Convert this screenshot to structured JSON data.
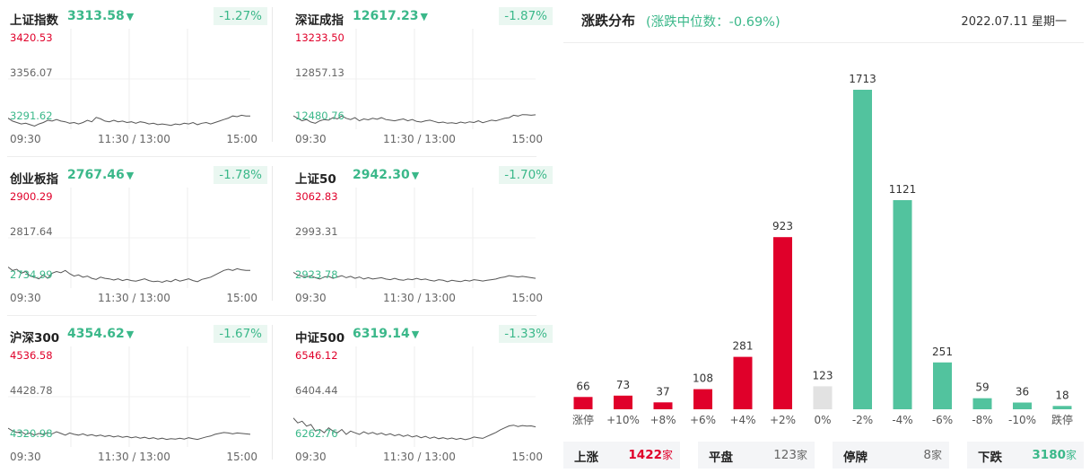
{
  "indices": [
    {
      "name": "上证指数",
      "value": "3313.58",
      "change": "-1.27%",
      "y_high": "3420.53",
      "y_mid": "3356.07",
      "y_low": "3291.62",
      "series": [
        3302,
        3298,
        3296,
        3294,
        3295,
        3293,
        3291,
        3294,
        3296,
        3299,
        3298,
        3300,
        3298,
        3297,
        3295,
        3296,
        3294,
        3296,
        3299,
        3297,
        3303,
        3301,
        3298,
        3297,
        3299,
        3297,
        3298,
        3296,
        3297,
        3295,
        3297,
        3296,
        3294,
        3295,
        3293,
        3294,
        3293,
        3292,
        3294,
        3293,
        3295,
        3294,
        3296,
        3293,
        3295,
        3296,
        3294,
        3296,
        3298,
        3300,
        3302,
        3305,
        3304,
        3306,
        3305,
        3305
      ]
    },
    {
      "name": "深证成指",
      "value": "12617.23",
      "change": "-1.87%",
      "y_high": "13233.50",
      "y_mid": "12857.13",
      "y_low": "12480.76",
      "series": [
        12560,
        12540,
        12520,
        12530,
        12510,
        12500,
        12520,
        12530,
        12525,
        12545,
        12535,
        12560,
        12540,
        12530,
        12545,
        12520,
        12535,
        12528,
        12540,
        12532,
        12545,
        12530,
        12525,
        12520,
        12528,
        12535,
        12520,
        12530,
        12515,
        12510,
        12520,
        12525,
        12515,
        12505,
        12510,
        12500,
        12505,
        12498,
        12510,
        12502,
        12512,
        12506,
        12520,
        12505,
        12515,
        12525,
        12520,
        12530,
        12540,
        12545,
        12565,
        12558,
        12570,
        12568,
        12565,
        12568
      ]
    },
    {
      "name": "创业板指",
      "value": "2767.46",
      "change": "-1.78%",
      "y_high": "2900.29",
      "y_mid": "2817.64",
      "y_low": "2734.99",
      "series": [
        2766,
        2760,
        2762,
        2755,
        2758,
        2750,
        2748,
        2745,
        2752,
        2746,
        2755,
        2758,
        2756,
        2760,
        2754,
        2750,
        2752,
        2748,
        2750,
        2746,
        2744,
        2748,
        2746,
        2745,
        2743,
        2745,
        2742,
        2744,
        2742,
        2741,
        2743,
        2745,
        2742,
        2740,
        2741,
        2739,
        2742,
        2740,
        2744,
        2741,
        2743,
        2745,
        2742,
        2740,
        2744,
        2746,
        2748,
        2752,
        2756,
        2760,
        2762,
        2760,
        2763,
        2761,
        2760,
        2760
      ]
    },
    {
      "name": "上证50",
      "value": "2942.30",
      "change": "-1.70%",
      "y_high": "3062.83",
      "y_mid": "2993.31",
      "y_low": "2923.78",
      "series": [
        2942,
        2938,
        2936,
        2935,
        2937,
        2934,
        2932,
        2935,
        2936,
        2933,
        2935,
        2937,
        2934,
        2936,
        2933,
        2935,
        2932,
        2934,
        2932,
        2933,
        2934,
        2932,
        2931,
        2933,
        2931,
        2930,
        2932,
        2931,
        2933,
        2931,
        2932,
        2930,
        2929,
        2931,
        2930,
        2928,
        2930,
        2929,
        2928,
        2930,
        2929,
        2931,
        2930,
        2929,
        2930,
        2931,
        2932,
        2934,
        2935,
        2937,
        2936,
        2935,
        2936,
        2935,
        2934,
        2933
      ]
    },
    {
      "name": "沪深300",
      "value": "4354.62",
      "change": "-1.67%",
      "y_high": "4536.58",
      "y_mid": "4428.78",
      "y_low": "4320.98",
      "series": [
        4356,
        4350,
        4346,
        4348,
        4342,
        4345,
        4340,
        4344,
        4341,
        4346,
        4343,
        4348,
        4344,
        4340,
        4345,
        4342,
        4340,
        4343,
        4339,
        4341,
        4338,
        4340,
        4337,
        4339,
        4336,
        4338,
        4335,
        4337,
        4334,
        4336,
        4333,
        4335,
        4332,
        4334,
        4331,
        4333,
        4330,
        4332,
        4331,
        4333,
        4331,
        4334,
        4332,
        4330,
        4333,
        4336,
        4338,
        4342,
        4344,
        4346,
        4345,
        4343,
        4345,
        4344,
        4343,
        4342
      ]
    },
    {
      "name": "中证500",
      "value": "6319.14",
      "change": "-1.33%",
      "y_high": "6546.12",
      "y_mid": "6404.44",
      "y_low": "6262.76",
      "series": [
        6340,
        6325,
        6330,
        6315,
        6320,
        6300,
        6305,
        6295,
        6310,
        6300,
        6295,
        6305,
        6290,
        6300,
        6295,
        6290,
        6298,
        6292,
        6296,
        6290,
        6294,
        6288,
        6292,
        6286,
        6290,
        6284,
        6288,
        6282,
        6286,
        6280,
        6284,
        6278,
        6282,
        6277,
        6280,
        6276,
        6279,
        6275,
        6278,
        6274,
        6277,
        6282,
        6280,
        6278,
        6284,
        6290,
        6296,
        6304,
        6310,
        6316,
        6318,
        6314,
        6317,
        6315,
        6316,
        6313
      ]
    }
  ],
  "time_labels": [
    "09:30",
    "11:30 / 13:00",
    "15:00"
  ],
  "distribution": {
    "title": "涨跌分布",
    "subtitle": "(涨跌中位数：-0.69%)",
    "date": "2022.07.11 星期一",
    "chart_data": {
      "type": "bar",
      "categories": [
        "涨停",
        "+10%",
        "+8%",
        "+6%",
        "+4%",
        "+2%",
        "0%",
        "-2%",
        "-4%",
        "-6%",
        "-8%",
        "-10%",
        "跌停"
      ],
      "values": [
        66,
        73,
        37,
        108,
        281,
        923,
        123,
        1713,
        1121,
        251,
        59,
        36,
        18
      ],
      "colors": [
        "#e0002a",
        "#e0002a",
        "#e0002a",
        "#e0002a",
        "#e0002a",
        "#e0002a",
        "#e2e2e2",
        "#52c39e",
        "#52c39e",
        "#52c39e",
        "#52c39e",
        "#52c39e",
        "#52c39e"
      ],
      "ylim": [
        0,
        1713
      ]
    },
    "summary": [
      {
        "label": "上涨",
        "count": "1422",
        "unit": "家",
        "color": "#e0002a"
      },
      {
        "label": "平盘",
        "count": "123",
        "unit": "家",
        "color": "#666666"
      },
      {
        "label": "停牌",
        "count": "8",
        "unit": "家",
        "color": "#666666"
      },
      {
        "label": "下跌",
        "count": "3180",
        "unit": "家",
        "color": "#3bb88a"
      }
    ]
  },
  "colors": {
    "up": "#e0002a",
    "down": "#3bb88a",
    "flat": "#e2e2e2",
    "bar_down": "#52c39e"
  }
}
